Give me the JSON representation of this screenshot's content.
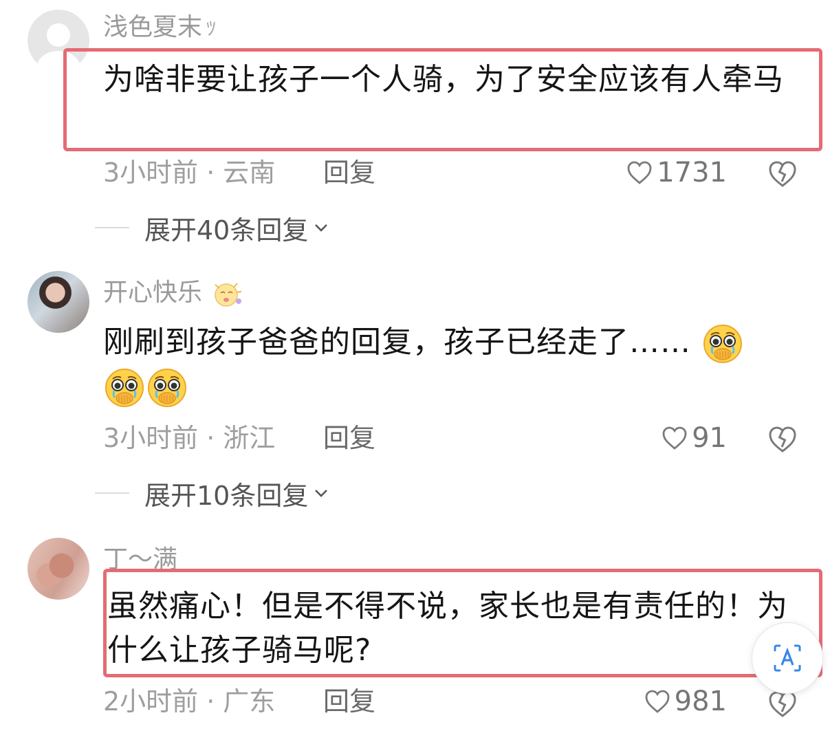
{
  "comments": [
    {
      "username": "浅色夏末",
      "username_suffix": "ﾂ",
      "text": "为啥非要让孩子一个人骑，为了安全应该有人牵马",
      "time": "3小时前",
      "location": "云南",
      "reply_label": "回复",
      "likes": "1731",
      "expand_label": "展开40条回复"
    },
    {
      "username": "开心快乐",
      "text": "刚刷到孩子爸爸的回复，孩子已经走了……",
      "emoji": "pleading-crying-face",
      "time": "3小时前",
      "location": "浙江",
      "reply_label": "回复",
      "likes": "91",
      "expand_label": "展开10条回复"
    },
    {
      "username": "丁～满",
      "text": "虽然痛心！但是不得不说，家长也是有责任的！为什么让孩子骑马呢?",
      "time": "2小时前",
      "location": "广东",
      "reply_label": "回复",
      "likes": "981"
    }
  ],
  "separator_dot": "·",
  "colors": {
    "highlight_border": "#e66a74",
    "username": "#9a9a9a",
    "body_text": "#151515",
    "meta": "#9e9e9e"
  },
  "icons": [
    "heart-outline-icon",
    "broken-heart-icon",
    "chevron-down-icon",
    "translate-icon"
  ]
}
